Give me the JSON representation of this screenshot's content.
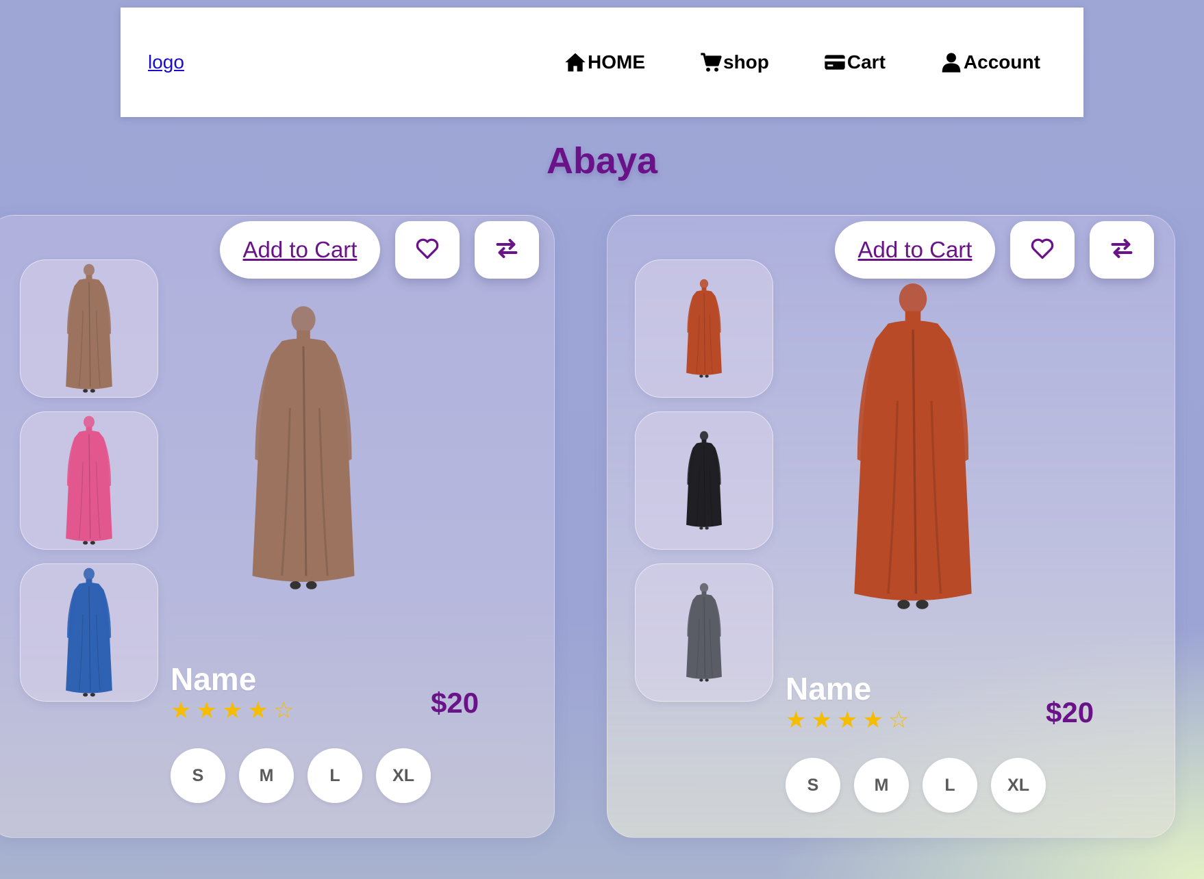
{
  "header": {
    "logo": "logo",
    "nav": [
      {
        "label": "HOME",
        "icon": "home-icon"
      },
      {
        "label": "shop",
        "icon": "shopping-cart-icon"
      },
      {
        "label": "Cart",
        "icon": "credit-card-icon"
      },
      {
        "label": "Account",
        "icon": "user-icon"
      }
    ]
  },
  "page": {
    "title": "Abaya"
  },
  "colors": {
    "accent": "#6a1288",
    "star": "#f6bd00",
    "link": "#1a0dcc"
  },
  "products": [
    {
      "add_to_cart": "Add to Cart",
      "name": "Name",
      "price": "$20",
      "rating": 4,
      "rating_max": 5,
      "sizes": [
        "S",
        "M",
        "L",
        "XL"
      ],
      "thumbnails": [
        "brown abaya",
        "pink abaya",
        "blue abaya"
      ],
      "main_image": "brown abaya",
      "colors": [
        "#9c735f",
        "#e2588e",
        "#2f62b2"
      ]
    },
    {
      "add_to_cart": "Add to Cart",
      "name": "Name",
      "price": "$20",
      "rating": 4,
      "rating_max": 5,
      "sizes": [
        "S",
        "M",
        "L",
        "XL"
      ],
      "thumbnails": [
        "orange abaya",
        "black abaya",
        "grey abaya"
      ],
      "main_image": "orange abaya",
      "colors": [
        "#b84a28",
        "#1f1f24",
        "#5a5c66"
      ]
    }
  ]
}
